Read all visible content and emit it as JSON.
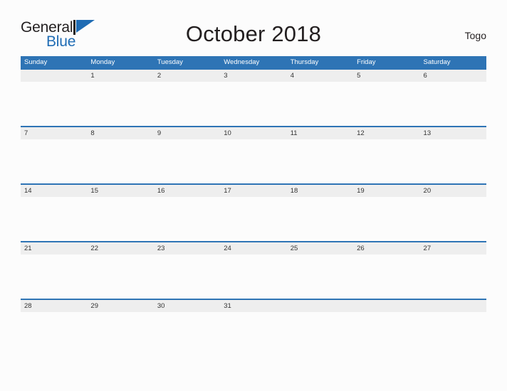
{
  "brand": {
    "name_part1": "General",
    "name_part2": "Blue",
    "mark_icon": "triangle-flag-icon",
    "accent_color": "#1f6cb4"
  },
  "header": {
    "title": "October 2018",
    "country": "Togo"
  },
  "colors": {
    "header_blue": "#2e74b5",
    "date_band_gray": "#eeeeee",
    "page_background": "#fcfcfc",
    "text_dark": "#231f20"
  },
  "calendar": {
    "month": "October",
    "year": "2018",
    "weekdays": [
      "Sunday",
      "Monday",
      "Tuesday",
      "Wednesday",
      "Thursday",
      "Friday",
      "Saturday"
    ],
    "weeks": [
      {
        "days": [
          {
            "date": ""
          },
          {
            "date": "1"
          },
          {
            "date": "2"
          },
          {
            "date": "3"
          },
          {
            "date": "4"
          },
          {
            "date": "5"
          },
          {
            "date": "6"
          }
        ]
      },
      {
        "days": [
          {
            "date": "7"
          },
          {
            "date": "8"
          },
          {
            "date": "9"
          },
          {
            "date": "10"
          },
          {
            "date": "11"
          },
          {
            "date": "12"
          },
          {
            "date": "13"
          }
        ]
      },
      {
        "days": [
          {
            "date": "14"
          },
          {
            "date": "15"
          },
          {
            "date": "16"
          },
          {
            "date": "17"
          },
          {
            "date": "18"
          },
          {
            "date": "19"
          },
          {
            "date": "20"
          }
        ]
      },
      {
        "days": [
          {
            "date": "21"
          },
          {
            "date": "22"
          },
          {
            "date": "23"
          },
          {
            "date": "24"
          },
          {
            "date": "25"
          },
          {
            "date": "26"
          },
          {
            "date": "27"
          }
        ]
      },
      {
        "days": [
          {
            "date": "28"
          },
          {
            "date": "29"
          },
          {
            "date": "30"
          },
          {
            "date": "31"
          },
          {
            "date": ""
          },
          {
            "date": ""
          },
          {
            "date": ""
          }
        ]
      }
    ]
  }
}
